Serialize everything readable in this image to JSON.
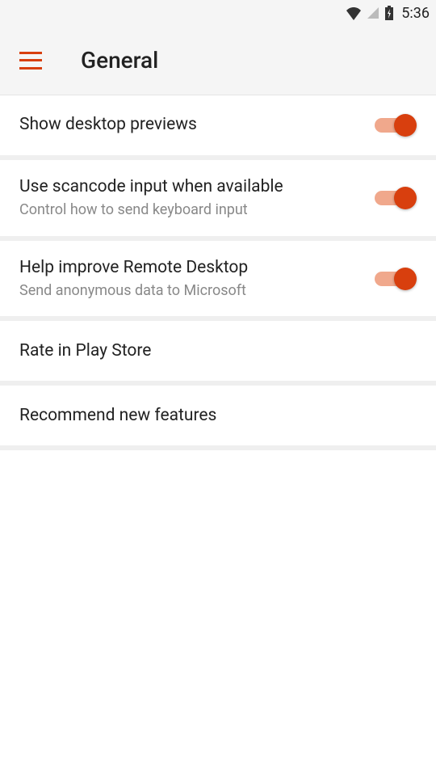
{
  "statusbar": {
    "time": "5:36"
  },
  "appbar": {
    "title": "General"
  },
  "settings": [
    {
      "title": "Show desktop previews",
      "subtitle": "",
      "toggle": true
    },
    {
      "title": "Use scancode input when available",
      "subtitle": "Control how to send keyboard input",
      "toggle": true
    },
    {
      "title": "Help improve Remote Desktop",
      "subtitle": "Send anonymous data to Microsoft",
      "toggle": true
    },
    {
      "title": "Rate in Play Store",
      "subtitle": "",
      "toggle": false
    },
    {
      "title": "Recommend new features",
      "subtitle": "",
      "toggle": false
    }
  ]
}
